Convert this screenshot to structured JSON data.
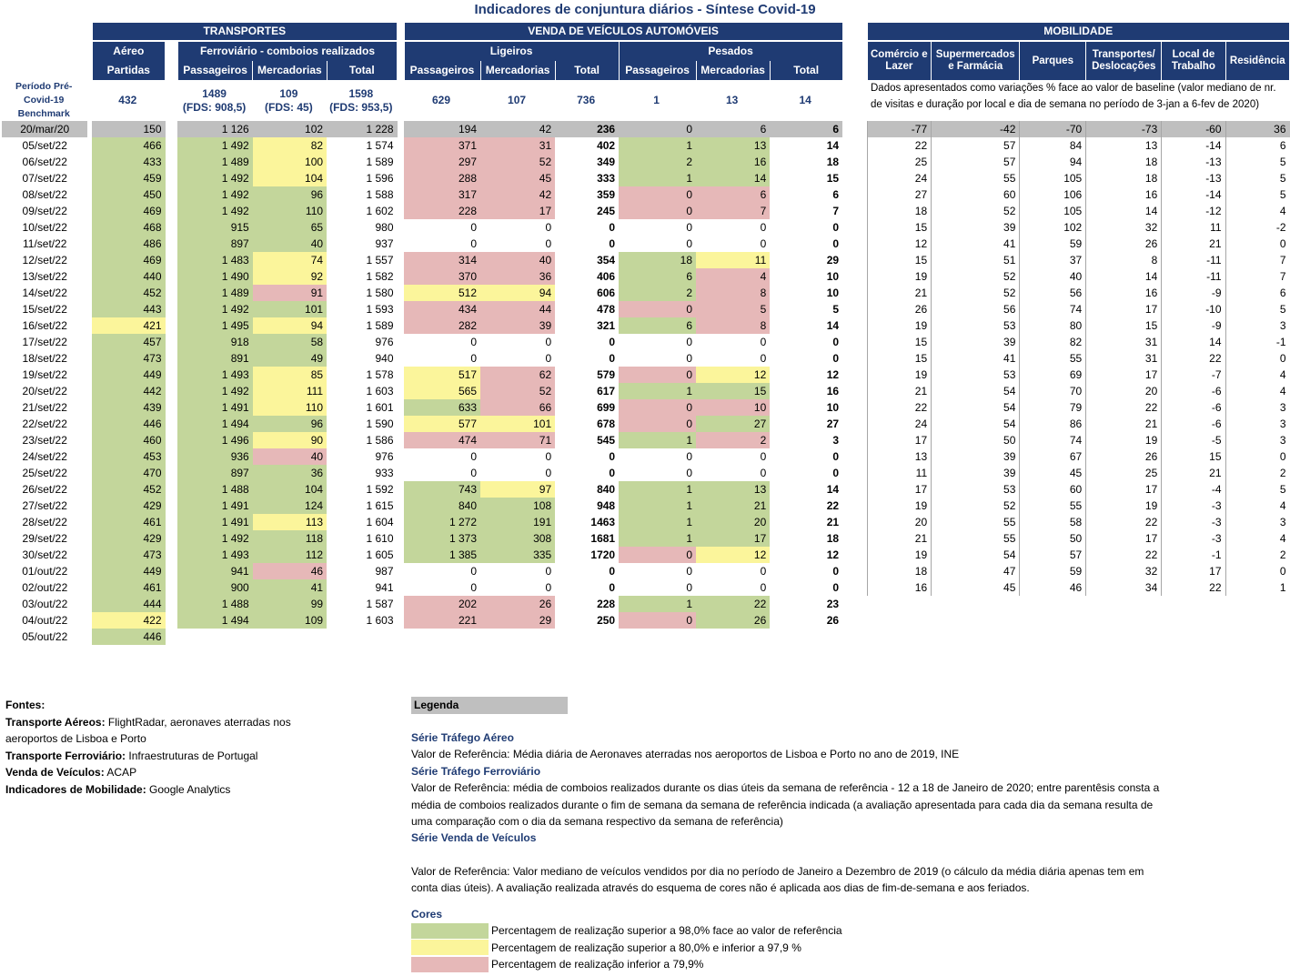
{
  "title": "Indicadores de conjuntura diários - Síntese Covid-19",
  "groups": {
    "transportes": "TRANSPORTES",
    "venda": "VENDA DE VEÍCULOS AUTOMÓVEIS",
    "mobilidade": "MOBILIDADE"
  },
  "sub": {
    "aereo": "Aéreo",
    "ferro": "Ferroviário - comboios realizados",
    "ligeiros": "Ligeiros",
    "pesados": "Pesados"
  },
  "cols": {
    "partidas": "Partidas",
    "passageiros": "Passageiros",
    "mercadorias": "Mercadorias",
    "total": "Total"
  },
  "mob_cols": [
    "Comércio e Lazer",
    "Supermercados e Farmácia",
    "Parques",
    "Transportes/ Deslocações",
    "Local de Trabalho",
    "Residência"
  ],
  "benchmark": {
    "label": "Período Pré-Covid-19 Benchmark",
    "aereo": "432",
    "fp": "1489",
    "fp2": "(FDS: 908,5)",
    "fm": "109",
    "fm2": "(FDS: 45)",
    "ft": "1598",
    "ft2": "(FDS: 953,5)",
    "lp": "629",
    "lm": "107",
    "lt": "736",
    "pp": "1",
    "pm": "13",
    "pt": "14",
    "note": "Dados apresentados como variações % face ao valor de baseline (valor mediano de nr. de visitas e duração por local e dia de semana no período de 3-jan a 6-fev de 2020)"
  },
  "ref_row": {
    "date": "20/mar/20",
    "v": [
      "150",
      "1 126",
      "102",
      "1 228",
      "194",
      "42",
      "236",
      "0",
      "6",
      "6"
    ],
    "m": [
      "-77",
      "-42",
      "-70",
      "-73",
      "-60",
      "36"
    ]
  },
  "rows": [
    {
      "d": "05/set/22",
      "v": [
        "466",
        "1 492",
        "82",
        "1 574",
        "371",
        "31",
        "402",
        "1",
        "13",
        "14"
      ],
      "c": [
        "g",
        "g",
        "y",
        "",
        "r",
        "r",
        "",
        "g",
        "g",
        ""
      ],
      "m": [
        "22",
        "57",
        "84",
        "13",
        "-14",
        "6"
      ]
    },
    {
      "d": "06/set/22",
      "v": [
        "433",
        "1 489",
        "100",
        "1 589",
        "297",
        "52",
        "349",
        "2",
        "16",
        "18"
      ],
      "c": [
        "g",
        "g",
        "y",
        "",
        "r",
        "r",
        "",
        "g",
        "g",
        ""
      ],
      "m": [
        "25",
        "57",
        "94",
        "18",
        "-13",
        "5"
      ]
    },
    {
      "d": "07/set/22",
      "v": [
        "459",
        "1 492",
        "104",
        "1 596",
        "288",
        "45",
        "333",
        "1",
        "14",
        "15"
      ],
      "c": [
        "g",
        "g",
        "y",
        "",
        "r",
        "r",
        "",
        "g",
        "g",
        ""
      ],
      "m": [
        "24",
        "55",
        "105",
        "18",
        "-13",
        "5"
      ]
    },
    {
      "d": "08/set/22",
      "v": [
        "450",
        "1 492",
        "96",
        "1 588",
        "317",
        "42",
        "359",
        "0",
        "6",
        "6"
      ],
      "c": [
        "g",
        "g",
        "g",
        "",
        "r",
        "r",
        "",
        "r",
        "r",
        ""
      ],
      "m": [
        "27",
        "60",
        "106",
        "16",
        "-14",
        "5"
      ]
    },
    {
      "d": "09/set/22",
      "v": [
        "469",
        "1 492",
        "110",
        "1 602",
        "228",
        "17",
        "245",
        "0",
        "7",
        "7"
      ],
      "c": [
        "g",
        "g",
        "g",
        "",
        "r",
        "r",
        "",
        "r",
        "r",
        ""
      ],
      "m": [
        "18",
        "52",
        "105",
        "14",
        "-12",
        "4"
      ]
    },
    {
      "d": "10/set/22",
      "v": [
        "468",
        "915",
        "65",
        "980",
        "0",
        "0",
        "0",
        "0",
        "0",
        "0"
      ],
      "c": [
        "g",
        "g",
        "g",
        "",
        "",
        "",
        "",
        "",
        "",
        ""
      ],
      "m": [
        "15",
        "39",
        "102",
        "32",
        "11",
        "-2"
      ]
    },
    {
      "d": "11/set/22",
      "v": [
        "486",
        "897",
        "40",
        "937",
        "0",
        "0",
        "0",
        "0",
        "0",
        "0"
      ],
      "c": [
        "g",
        "g",
        "g",
        "",
        "",
        "",
        "",
        "",
        "",
        ""
      ],
      "m": [
        "12",
        "41",
        "59",
        "26",
        "21",
        "0"
      ]
    },
    {
      "d": "12/set/22",
      "v": [
        "469",
        "1 483",
        "74",
        "1 557",
        "314",
        "40",
        "354",
        "18",
        "11",
        "29"
      ],
      "c": [
        "g",
        "g",
        "y",
        "",
        "r",
        "r",
        "",
        "g",
        "y",
        ""
      ],
      "m": [
        "15",
        "51",
        "37",
        "8",
        "-11",
        "7"
      ]
    },
    {
      "d": "13/set/22",
      "v": [
        "440",
        "1 490",
        "92",
        "1 582",
        "370",
        "36",
        "406",
        "6",
        "4",
        "10"
      ],
      "c": [
        "g",
        "g",
        "y",
        "",
        "r",
        "r",
        "",
        "g",
        "r",
        ""
      ],
      "m": [
        "19",
        "52",
        "40",
        "14",
        "-11",
        "7"
      ]
    },
    {
      "d": "14/set/22",
      "v": [
        "452",
        "1 489",
        "91",
        "1 580",
        "512",
        "94",
        "606",
        "2",
        "8",
        "10"
      ],
      "c": [
        "g",
        "g",
        "r",
        "",
        "y",
        "y",
        "",
        "g",
        "r",
        ""
      ],
      "m": [
        "21",
        "52",
        "56",
        "16",
        "-9",
        "6"
      ]
    },
    {
      "d": "15/set/22",
      "v": [
        "443",
        "1 492",
        "101",
        "1 593",
        "434",
        "44",
        "478",
        "0",
        "5",
        "5"
      ],
      "c": [
        "g",
        "g",
        "g",
        "",
        "r",
        "r",
        "",
        "r",
        "r",
        ""
      ],
      "m": [
        "26",
        "56",
        "74",
        "17",
        "-10",
        "5"
      ]
    },
    {
      "d": "16/set/22",
      "v": [
        "421",
        "1 495",
        "94",
        "1 589",
        "282",
        "39",
        "321",
        "6",
        "8",
        "14"
      ],
      "c": [
        "y",
        "g",
        "y",
        "",
        "r",
        "r",
        "",
        "g",
        "r",
        ""
      ],
      "m": [
        "19",
        "53",
        "80",
        "15",
        "-9",
        "3"
      ]
    },
    {
      "d": "17/set/22",
      "v": [
        "457",
        "918",
        "58",
        "976",
        "0",
        "0",
        "0",
        "0",
        "0",
        "0"
      ],
      "c": [
        "g",
        "g",
        "g",
        "",
        "",
        "",
        "",
        "",
        "",
        ""
      ],
      "m": [
        "15",
        "39",
        "82",
        "31",
        "14",
        "-1"
      ]
    },
    {
      "d": "18/set/22",
      "v": [
        "473",
        "891",
        "49",
        "940",
        "0",
        "0",
        "0",
        "0",
        "0",
        "0"
      ],
      "c": [
        "g",
        "g",
        "g",
        "",
        "",
        "",
        "",
        "",
        "",
        ""
      ],
      "m": [
        "15",
        "41",
        "55",
        "31",
        "22",
        "0"
      ]
    },
    {
      "d": "19/set/22",
      "v": [
        "449",
        "1 493",
        "85",
        "1 578",
        "517",
        "62",
        "579",
        "0",
        "12",
        "12"
      ],
      "c": [
        "g",
        "g",
        "y",
        "",
        "y",
        "r",
        "",
        "r",
        "y",
        ""
      ],
      "m": [
        "19",
        "53",
        "69",
        "17",
        "-7",
        "4"
      ]
    },
    {
      "d": "20/set/22",
      "v": [
        "442",
        "1 492",
        "111",
        "1 603",
        "565",
        "52",
        "617",
        "1",
        "15",
        "16"
      ],
      "c": [
        "g",
        "g",
        "y",
        "",
        "y",
        "r",
        "",
        "g",
        "g",
        ""
      ],
      "m": [
        "21",
        "54",
        "70",
        "20",
        "-6",
        "4"
      ]
    },
    {
      "d": "21/set/22",
      "v": [
        "439",
        "1 491",
        "110",
        "1 601",
        "633",
        "66",
        "699",
        "0",
        "10",
        "10"
      ],
      "c": [
        "g",
        "g",
        "y",
        "",
        "g",
        "r",
        "",
        "r",
        "r",
        ""
      ],
      "m": [
        "22",
        "54",
        "79",
        "22",
        "-6",
        "3"
      ]
    },
    {
      "d": "22/set/22",
      "v": [
        "446",
        "1 494",
        "96",
        "1 590",
        "577",
        "101",
        "678",
        "0",
        "27",
        "27"
      ],
      "c": [
        "g",
        "g",
        "g",
        "",
        "y",
        "y",
        "",
        "r",
        "g",
        ""
      ],
      "m": [
        "24",
        "54",
        "86",
        "21",
        "-6",
        "3"
      ]
    },
    {
      "d": "23/set/22",
      "v": [
        "460",
        "1 496",
        "90",
        "1 586",
        "474",
        "71",
        "545",
        "1",
        "2",
        "3"
      ],
      "c": [
        "g",
        "g",
        "y",
        "",
        "r",
        "r",
        "",
        "g",
        "r",
        ""
      ],
      "m": [
        "17",
        "50",
        "74",
        "19",
        "-5",
        "3"
      ]
    },
    {
      "d": "24/set/22",
      "v": [
        "453",
        "936",
        "40",
        "976",
        "0",
        "0",
        "0",
        "0",
        "0",
        "0"
      ],
      "c": [
        "g",
        "g",
        "r",
        "",
        "",
        "",
        "",
        "",
        "",
        ""
      ],
      "m": [
        "13",
        "39",
        "67",
        "26",
        "15",
        "0"
      ]
    },
    {
      "d": "25/set/22",
      "v": [
        "470",
        "897",
        "36",
        "933",
        "0",
        "0",
        "0",
        "0",
        "0",
        "0"
      ],
      "c": [
        "g",
        "g",
        "g",
        "",
        "",
        "",
        "",
        "",
        "",
        ""
      ],
      "m": [
        "11",
        "39",
        "45",
        "25",
        "21",
        "2"
      ]
    },
    {
      "d": "26/set/22",
      "v": [
        "452",
        "1 488",
        "104",
        "1 592",
        "743",
        "97",
        "840",
        "1",
        "13",
        "14"
      ],
      "c": [
        "g",
        "g",
        "g",
        "",
        "g",
        "y",
        "",
        "g",
        "g",
        ""
      ],
      "m": [
        "17",
        "53",
        "60",
        "17",
        "-4",
        "5"
      ]
    },
    {
      "d": "27/set/22",
      "v": [
        "429",
        "1 491",
        "124",
        "1 615",
        "840",
        "108",
        "948",
        "1",
        "21",
        "22"
      ],
      "c": [
        "g",
        "g",
        "g",
        "",
        "g",
        "g",
        "",
        "g",
        "g",
        ""
      ],
      "m": [
        "19",
        "52",
        "55",
        "19",
        "-3",
        "4"
      ]
    },
    {
      "d": "28/set/22",
      "v": [
        "461",
        "1 491",
        "113",
        "1 604",
        "1 272",
        "191",
        "1463",
        "1",
        "20",
        "21"
      ],
      "c": [
        "g",
        "g",
        "y",
        "",
        "g",
        "g",
        "",
        "g",
        "g",
        ""
      ],
      "m": [
        "20",
        "55",
        "58",
        "22",
        "-3",
        "3"
      ]
    },
    {
      "d": "29/set/22",
      "v": [
        "429",
        "1 492",
        "118",
        "1 610",
        "1 373",
        "308",
        "1681",
        "1",
        "17",
        "18"
      ],
      "c": [
        "g",
        "g",
        "g",
        "",
        "g",
        "g",
        "",
        "g",
        "g",
        ""
      ],
      "m": [
        "21",
        "55",
        "50",
        "17",
        "-3",
        "4"
      ]
    },
    {
      "d": "30/set/22",
      "v": [
        "473",
        "1 493",
        "112",
        "1 605",
        "1 385",
        "335",
        "1720",
        "0",
        "12",
        "12"
      ],
      "c": [
        "g",
        "g",
        "g",
        "",
        "g",
        "g",
        "",
        "r",
        "y",
        ""
      ],
      "m": [
        "19",
        "54",
        "57",
        "22",
        "-1",
        "2"
      ]
    },
    {
      "d": "01/out/22",
      "v": [
        "449",
        "941",
        "46",
        "987",
        "0",
        "0",
        "0",
        "0",
        "0",
        "0"
      ],
      "c": [
        "g",
        "g",
        "r",
        "",
        "",
        "",
        "",
        "",
        "",
        ""
      ],
      "m": [
        "18",
        "47",
        "59",
        "32",
        "17",
        "0"
      ]
    },
    {
      "d": "02/out/22",
      "v": [
        "461",
        "900",
        "41",
        "941",
        "0",
        "0",
        "0",
        "0",
        "0",
        "0"
      ],
      "c": [
        "g",
        "g",
        "g",
        "",
        "",
        "",
        "",
        "",
        "",
        ""
      ],
      "m": [
        "16",
        "45",
        "46",
        "34",
        "22",
        "1"
      ]
    },
    {
      "d": "03/out/22",
      "v": [
        "444",
        "1 488",
        "99",
        "1 587",
        "202",
        "26",
        "228",
        "1",
        "22",
        "23"
      ],
      "c": [
        "g",
        "g",
        "g",
        "",
        "r",
        "r",
        "",
        "g",
        "g",
        ""
      ],
      "m": []
    },
    {
      "d": "04/out/22",
      "v": [
        "422",
        "1 494",
        "109",
        "1 603",
        "221",
        "29",
        "250",
        "0",
        "26",
        "26"
      ],
      "c": [
        "y",
        "g",
        "g",
        "",
        "r",
        "r",
        "",
        "r",
        "g",
        ""
      ],
      "m": []
    },
    {
      "d": "05/out/22",
      "v": [
        "446"
      ],
      "c": [
        "g"
      ],
      "m": []
    }
  ],
  "fontes": {
    "title": "Fontes:",
    "items": [
      {
        "k": "Transporte Aéreos:",
        "v": " FlightRadar, aeronaves aterradas nos aeroportos de Lisboa e Porto"
      },
      {
        "k": "Transporte Ferroviário:",
        "v": " Infraestruturas de Portugal"
      },
      {
        "k": "Venda de Veículos:",
        "v": " ACAP"
      },
      {
        "k": "Indicadores de Mobilidade:",
        "v": " Google Analytics"
      }
    ]
  },
  "legenda": {
    "title": "Legenda",
    "s1": "Série Tráfego Aéreo",
    "t1": "Valor de Referência: Média diária de Aeronaves aterradas nos aeroportos de Lisboa e Porto no ano de 2019, INE",
    "s2": "Série Tráfego Ferroviário",
    "t2": "Valor de Referência: média de comboios realizados durante os dias úteis da semana de referência - 12 a 18 de Janeiro de 2020; entre parentêsis consta a média de comboios realizados durante o fim de semana da semana de referência indicada (a avaliação apresentada para cada dia da semana resulta de uma comparação com o dia da semana respectivo da semana de referência)",
    "s3": "Série Venda de Veículos",
    "t3": "Valor de Referência: Valor mediano de veículos vendidos por dia no período de Janeiro a Dezembro de 2019 (o cálculo da média diária apenas tem em conta dias úteis). A avaliação realizada através do esquema de cores não é aplicada aos dias de fim-de-semana e aos feriados.",
    "cores_title": "Cores",
    "cores": [
      {
        "color": "#c3d69b",
        "label": "Percentagem de realização superior a 98,0% face ao valor de referência"
      },
      {
        "color": "#fbf59b",
        "label": "Percentagem de realização superior a 80,0% e inferior a 97,9 %"
      },
      {
        "color": "#e6b8b8",
        "label": "Percentagem de realização inferior a 79,9%"
      }
    ]
  }
}
